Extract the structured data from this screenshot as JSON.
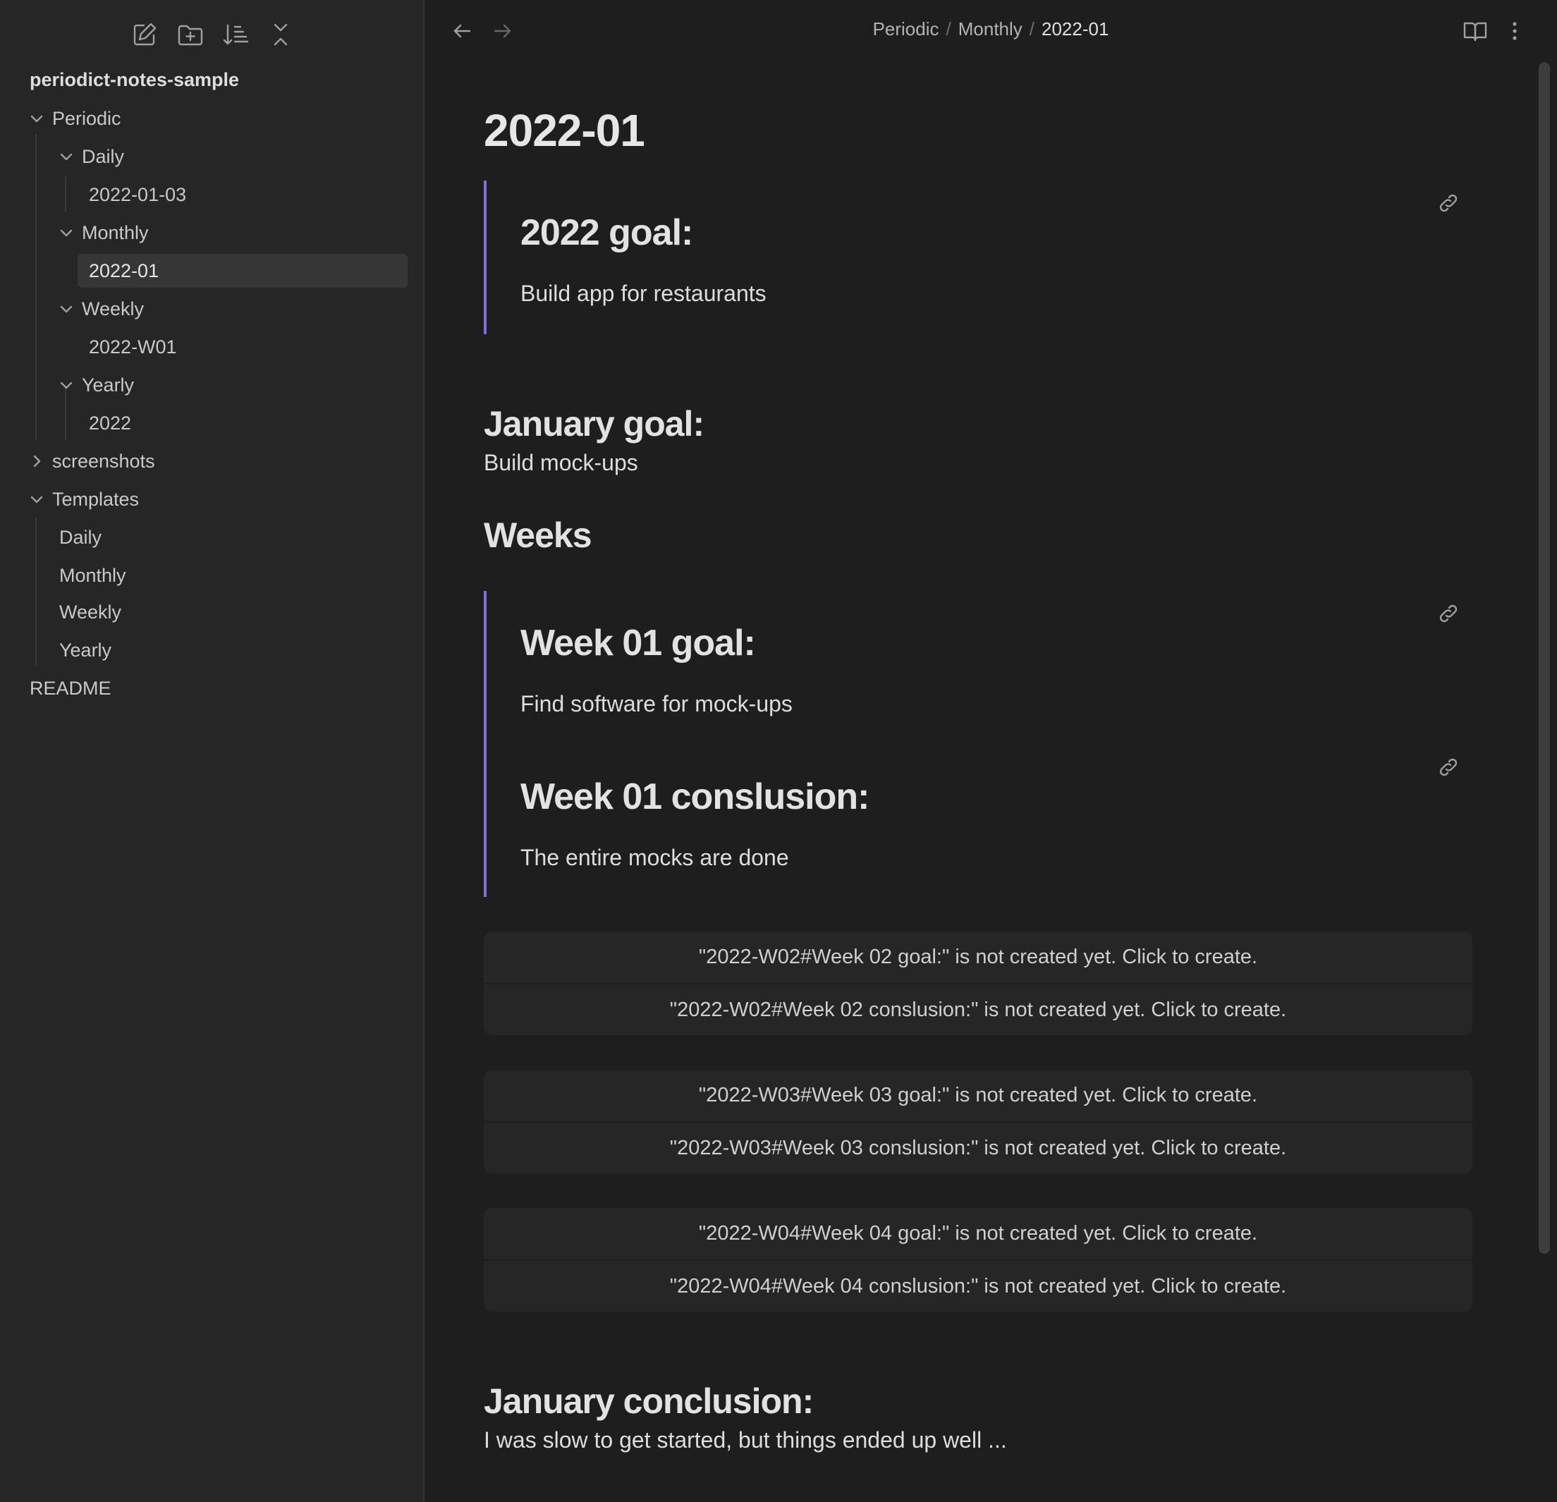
{
  "sidebar": {
    "toolbar": {
      "new_note_icon": "edit-icon",
      "new_folder_icon": "folder-plus-icon",
      "sort_icon": "sort-icon",
      "collapse_icon": "collapse-all-icon"
    },
    "vault_name": "periodict-notes-sample",
    "tree": {
      "periodic": "Periodic",
      "daily": "Daily",
      "daily_note": "2022-01-03",
      "monthly": "Monthly",
      "monthly_note": "2022-01",
      "weekly": "Weekly",
      "weekly_note": "2022-W01",
      "yearly": "Yearly",
      "yearly_note": "2022",
      "screenshots": "screenshots",
      "templates": "Templates",
      "tpl_daily": "Daily",
      "tpl_monthly": "Monthly",
      "tpl_weekly": "Weekly",
      "tpl_yearly": "Yearly",
      "readme": "README"
    }
  },
  "header": {
    "breadcrumb": [
      "Periodic",
      "Monthly",
      "2022-01"
    ],
    "separator": "/"
  },
  "note": {
    "title": "2022-01",
    "year_goal": {
      "heading": "2022 goal:",
      "text": "Build app for restaurants"
    },
    "january_goal": {
      "heading": "January goal:",
      "text": "Build mock-ups"
    },
    "weeks_heading": "Weeks",
    "week01_goal": {
      "heading": "Week 01 goal:",
      "text": "Find software for mock-ups"
    },
    "week01_conclusion": {
      "heading": "Week 01 conslusion:",
      "text": "The entire mocks are done"
    },
    "missing": [
      "\"2022-W02#Week 02 goal:\" is not created yet. Click to create.",
      "\"2022-W02#Week 02 conslusion:\" is not created yet. Click to create.",
      "\"2022-W03#Week 03 goal:\" is not created yet. Click to create.",
      "\"2022-W03#Week 03 conslusion:\" is not created yet. Click to create.",
      "\"2022-W04#Week 04 goal:\" is not created yet. Click to create.",
      "\"2022-W04#Week 04 conslusion:\" is not created yet. Click to create."
    ],
    "january_conclusion": {
      "heading": "January conclusion:",
      "text": "I was slow to get started, but things ended up well ..."
    }
  },
  "colors": {
    "accent": "#7c6fd6",
    "background": "#1e1e1e",
    "sidebar": "#262626"
  }
}
